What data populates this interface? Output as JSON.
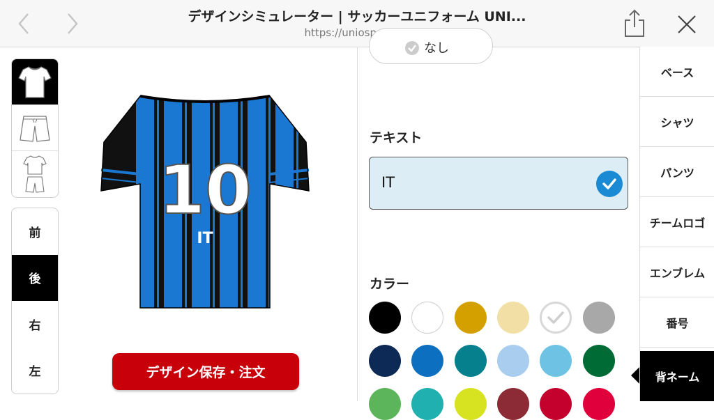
{
  "browser": {
    "title": "デザインシミュレーター | サッカーユニフォーム UNI...",
    "url": "https://uniosports.jp"
  },
  "thumbnails": [
    {
      "name": "shirt",
      "active": true
    },
    {
      "name": "shorts",
      "active": false
    },
    {
      "name": "set",
      "active": false
    }
  ],
  "views": [
    {
      "label": "前",
      "active": false
    },
    {
      "label": "後",
      "active": true
    },
    {
      "label": "右",
      "active": false
    },
    {
      "label": "左",
      "active": false
    }
  ],
  "jersey": {
    "number": "10",
    "name": "IT",
    "stripe_color": "#1a78d2",
    "base_color": "#111111"
  },
  "save_button": "デザイン保存・注文",
  "panel": {
    "none_label": "なし",
    "text_label": "テキスト",
    "text_value": "IT",
    "color_label": "カラー"
  },
  "swatches": [
    [
      "#000000",
      "#ffffff",
      "#d4a000",
      "#f1dfa6",
      "selected-white",
      "#a8a8a8"
    ],
    [
      "#0d2a57",
      "#0d6fc0",
      "#06808c",
      "#a9cdee",
      "#6ec2e4",
      "#006b35"
    ],
    [
      "#5db55b",
      "#20b0b0",
      "#d7e320",
      "#8c2a35",
      "#c4002d",
      "#e0003c"
    ]
  ],
  "menu": [
    {
      "label": "ベース",
      "active": false
    },
    {
      "label": "シャツ",
      "active": false
    },
    {
      "label": "パンツ",
      "active": false
    },
    {
      "label": "チームロゴ",
      "active": false
    },
    {
      "label": "エンブレム",
      "active": false
    },
    {
      "label": "番号",
      "active": false
    },
    {
      "label": "背ネーム",
      "active": true
    }
  ],
  "colors": {
    "accent_red": "#c8000a",
    "check_blue": "#1a8ad4",
    "input_bg": "#dcedf5"
  }
}
